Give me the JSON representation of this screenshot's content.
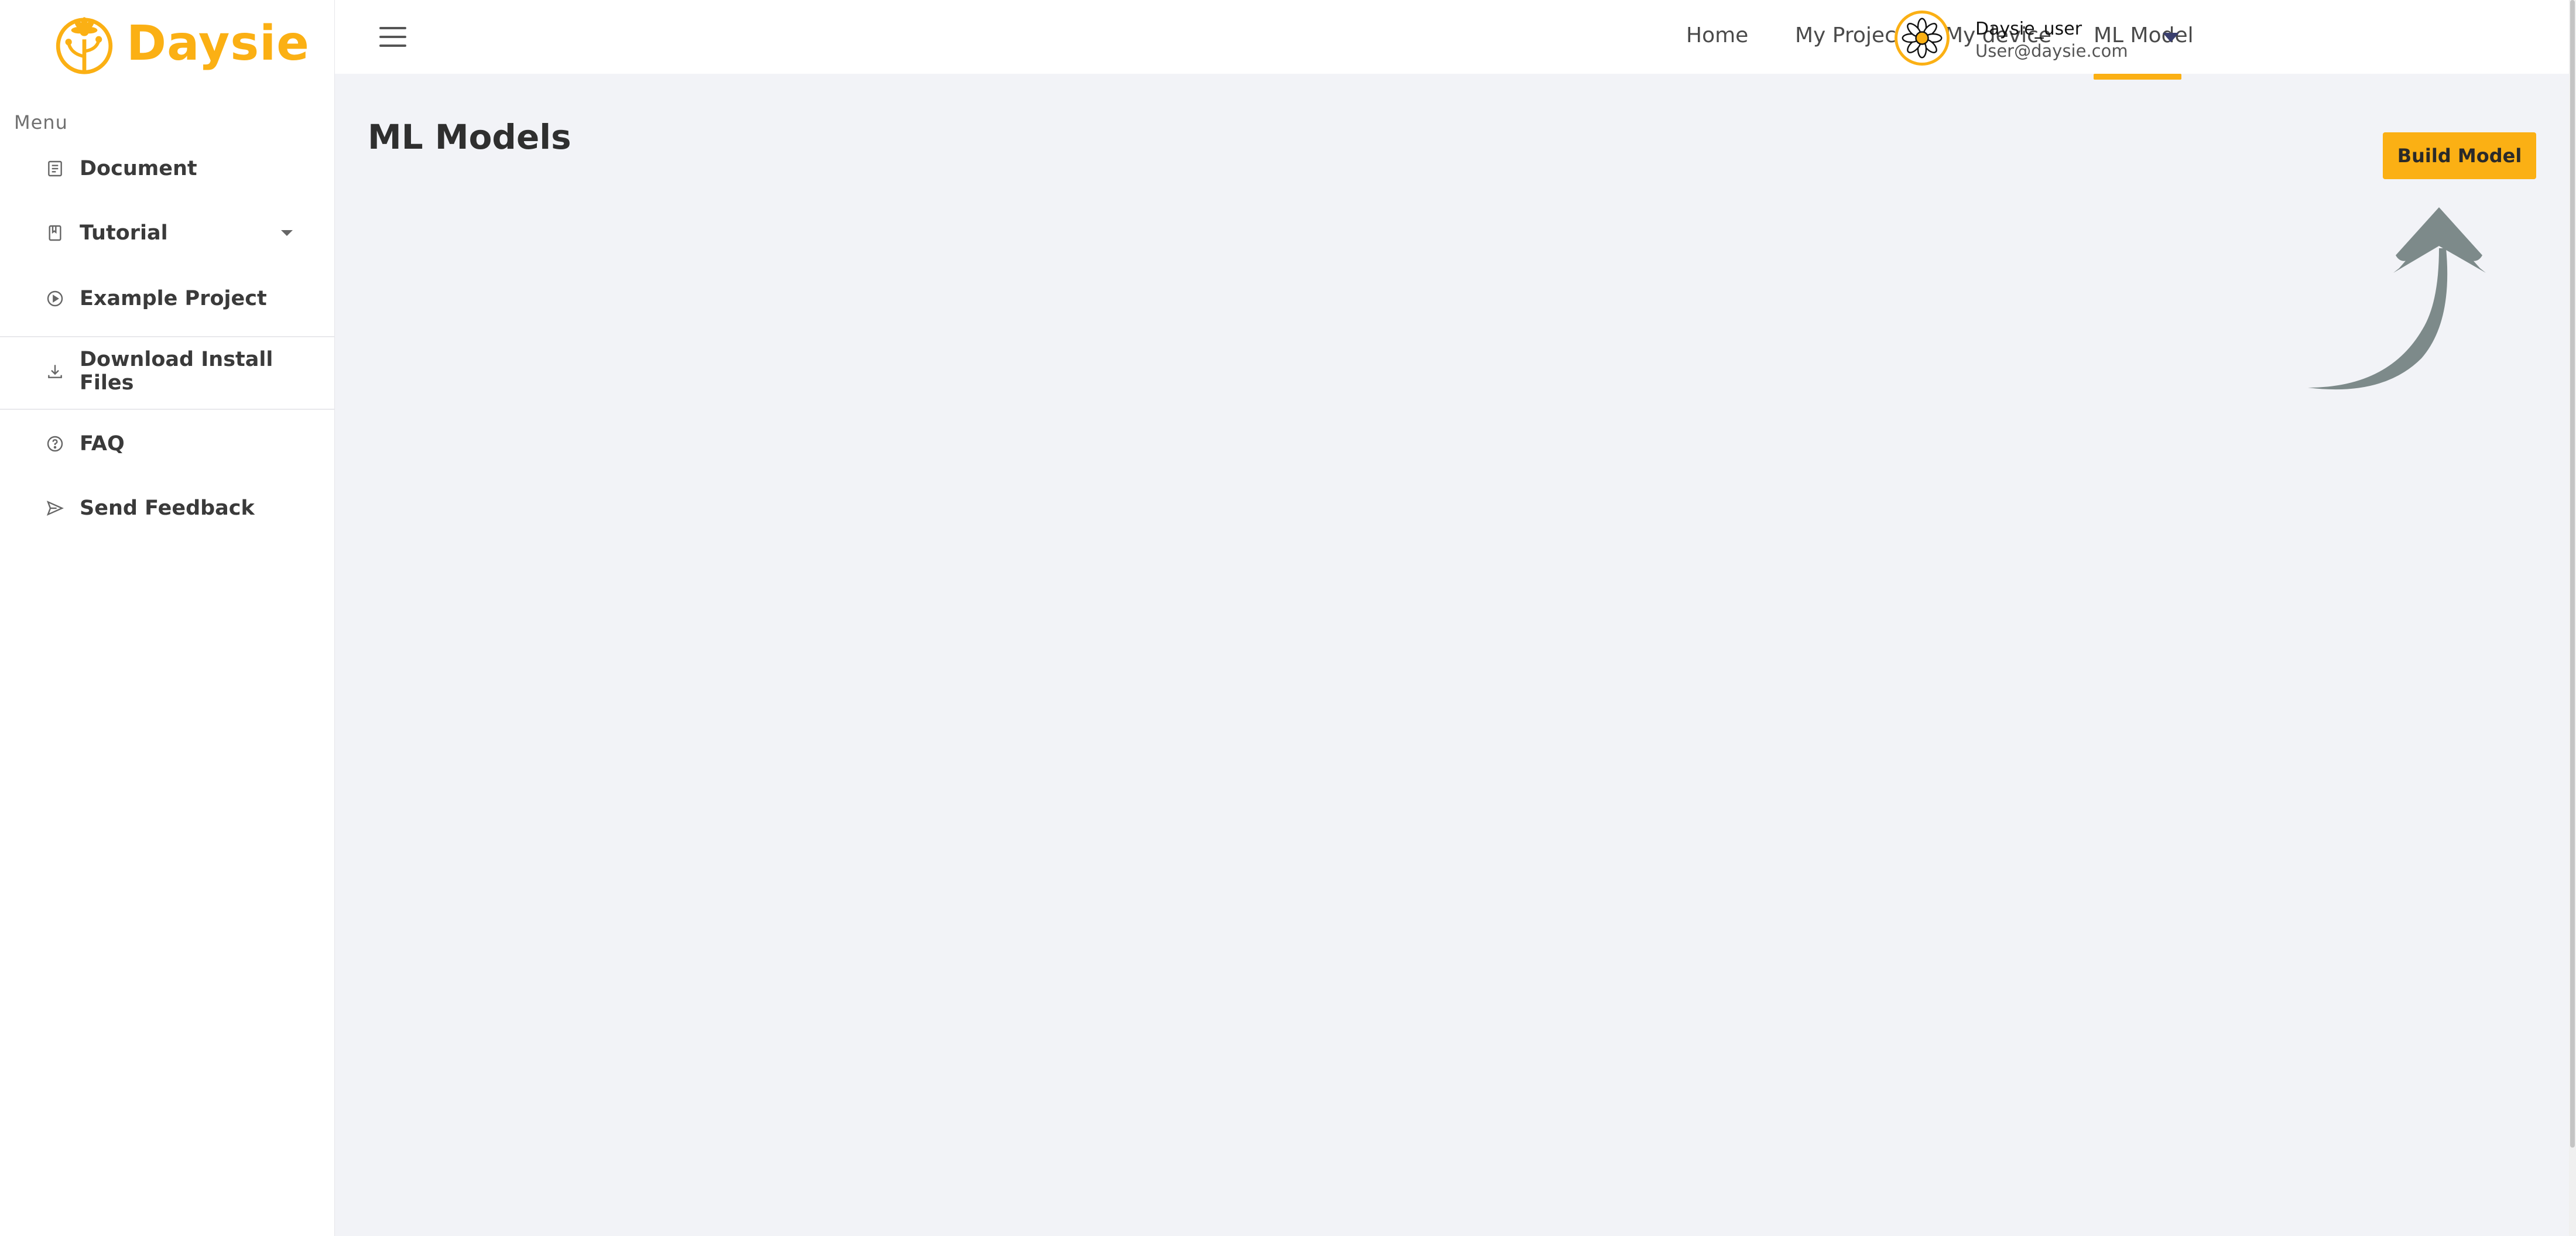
{
  "brand": {
    "name": "Daysie",
    "accent": "#fbb014"
  },
  "sidebar": {
    "menu_heading": "Menu",
    "items": [
      {
        "label": "Document",
        "icon": "document-icon"
      },
      {
        "label": "Tutorial",
        "icon": "book-icon",
        "has_dropdown": true
      },
      {
        "label": "Example Project",
        "icon": "play-circle-icon"
      },
      {
        "label": "Download Install Files",
        "icon": "download-icon"
      },
      {
        "label": "FAQ",
        "icon": "help-circle-icon"
      },
      {
        "label": "Send Feedback",
        "icon": "send-icon"
      }
    ]
  },
  "topbar": {
    "menu_icon": "hamburger-icon",
    "nav": [
      {
        "label": "Home"
      },
      {
        "label": "My Project"
      },
      {
        "label": "My device"
      },
      {
        "label": "ML Model",
        "active": true
      }
    ],
    "user": {
      "name": "Daysie_user",
      "email": "User@daysie.com"
    }
  },
  "main": {
    "title": "ML Models",
    "build_button": "Build Model",
    "hint_arrow_color": "#7d8a8a"
  }
}
